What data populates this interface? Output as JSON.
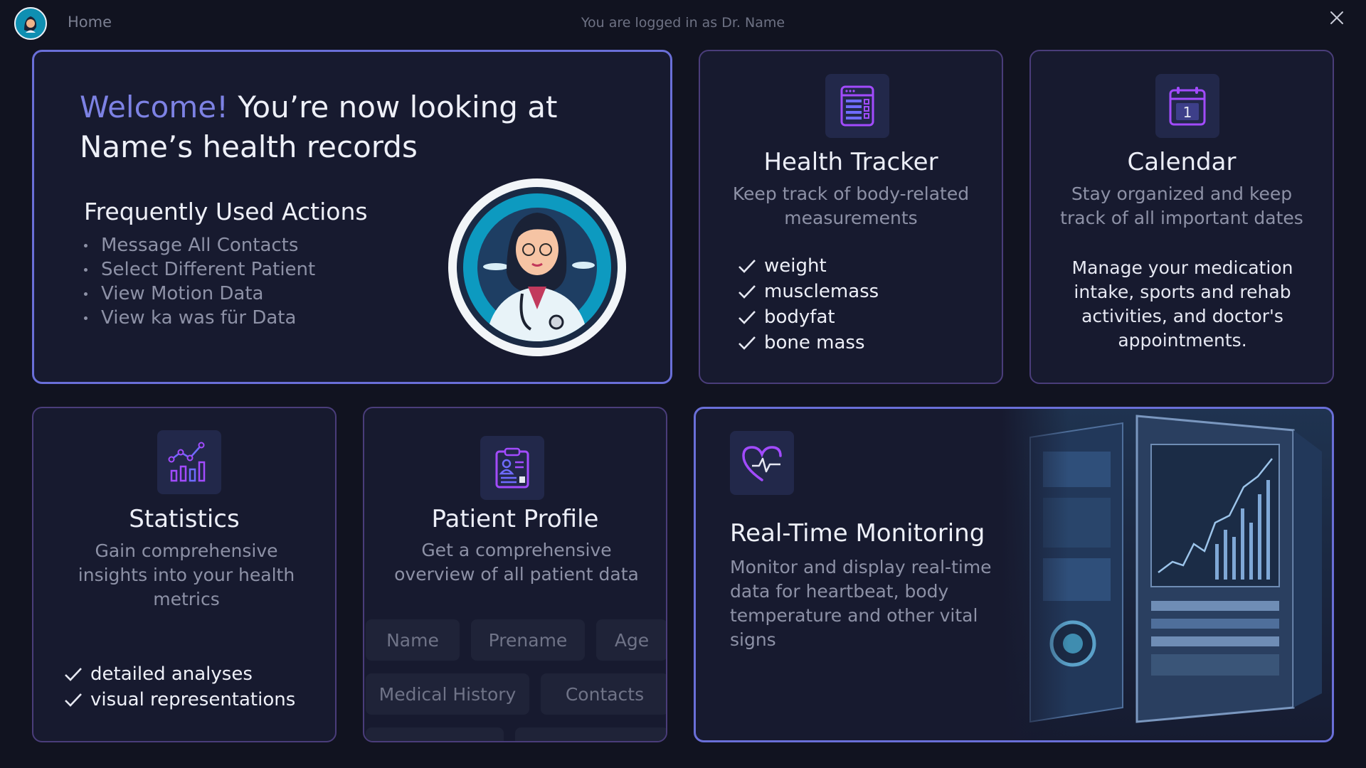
{
  "topbar": {
    "home_label": "Home",
    "login_text": "You are logged in as Dr. Name"
  },
  "welcome": {
    "welcome_word": "Welcome!",
    "title_rest_line1": " You’re now looking at",
    "title_line2": "Name’s health records",
    "actions_title": "Frequently Used Actions",
    "actions": [
      "Message All Contacts",
      "Select Different Patient",
      "View Motion Data",
      "View ka was für Data"
    ]
  },
  "health_tracker": {
    "title": "Health Tracker",
    "description": "Keep track of body-related measurements",
    "features": [
      "weight",
      "musclemass",
      "bodyfat",
      "bone mass"
    ]
  },
  "calendar": {
    "title": "Calendar",
    "description": "Stay organized and keep track of all important dates",
    "details": "Manage your medication intake, sports and rehab activities, and doctor's appointments.",
    "icon_day": "1"
  },
  "statistics": {
    "title": "Statistics",
    "description": "Gain comprehensive insights into your health metrics",
    "features": [
      "detailed analyses",
      "visual representations"
    ]
  },
  "patient_profile": {
    "title": "Patient Profile",
    "description": "Get a comprehensive overview of all patient data",
    "fields": [
      "Name",
      "Prename",
      "Age",
      "Medical History",
      "Contacts"
    ]
  },
  "monitoring": {
    "title": "Real-Time Monitoring",
    "description": "Monitor and display real-time data for heartbeat, body temperature and other vital signs"
  },
  "colors": {
    "background": "#111320",
    "card": "#171a2f",
    "card_border": "#4a3d7a",
    "active_border": "#6a6fd8",
    "accent": "#7d82e4"
  }
}
